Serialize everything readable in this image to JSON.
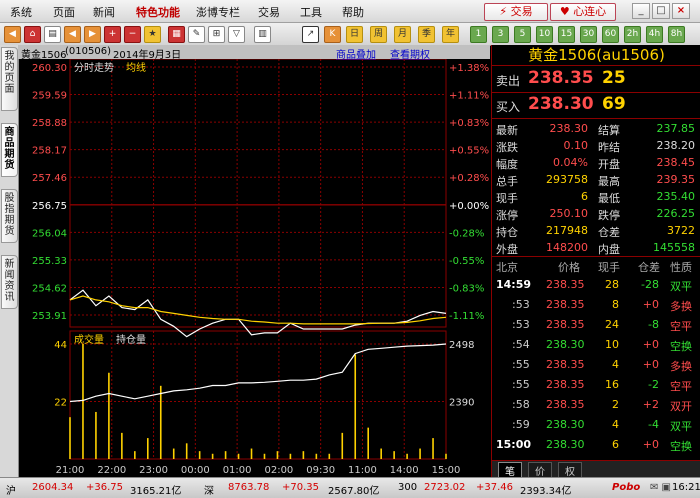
{
  "menu": {
    "items": [
      "系统",
      "页面",
      "新闻",
      "特色功能",
      "澎博专栏",
      "交易",
      "工具",
      "帮助"
    ],
    "trade_button": "交易",
    "xinlianxin_button": "心连心",
    "win_min": "_",
    "win_max": "□",
    "win_close": "×"
  },
  "toolbar": {
    "icons": [
      "home-icon",
      "page-icon",
      "prev-icon",
      "next-icon",
      "zoom-in-icon",
      "zoom-out-icon",
      "analysis-icon",
      "pen-icon",
      "split-icon",
      "filter-icon",
      "table-icon",
      "tick-chart-icon",
      "kline-icon"
    ],
    "period_buttons": [
      "日",
      "周",
      "月",
      "季",
      "年"
    ],
    "num_buttons": [
      "1",
      "3",
      "5",
      "10",
      "15",
      "30",
      "60",
      "2h",
      "4h",
      "8h"
    ],
    "gray_label": "日"
  },
  "left_tabs": [
    "我的页面",
    "商品期货",
    "股指期货",
    "新闻资讯"
  ],
  "chart": {
    "header": {
      "name": "黄金1506",
      "code": "(010506)",
      "date": "2014年9月3日",
      "link1": "商品叠加",
      "link2": "查看期权"
    },
    "price_label": "分时走势",
    "ma_label": "均线",
    "vol_label": "成交量",
    "oi_label": "持仓量",
    "price_ticks": [
      "260.30",
      "259.59",
      "258.88",
      "258.17",
      "257.46",
      "256.75",
      "256.04",
      "255.33",
      "254.62",
      "253.91"
    ],
    "pct_ticks": [
      "+1.38%",
      "+1.11%",
      "+0.83%",
      "+0.55%",
      "+0.28%",
      "+0.00%",
      "-0.28%",
      "-0.55%",
      "-0.83%",
      "-1.11%"
    ],
    "vol_ticks": [
      "44",
      "22"
    ],
    "oi_ticks": [
      "2498",
      "2390"
    ],
    "time_ticks": [
      "21:00",
      "22:00",
      "23:00",
      "00:00",
      "01:00",
      "02:00",
      "09:30",
      "11:00",
      "14:00",
      "15:00"
    ]
  },
  "chart_data": {
    "type": "line",
    "title": "分时走势",
    "x": [
      "21:00",
      "21:10",
      "21:20",
      "21:30",
      "21:40",
      "21:50",
      "22:00",
      "22:10",
      "22:20",
      "22:30",
      "22:40",
      "22:50",
      "23:00",
      "23:30",
      "00:00",
      "00:30",
      "01:00",
      "01:30",
      "02:00",
      "02:30",
      "09:00",
      "09:30",
      "10:00",
      "10:30",
      "11:00",
      "11:30",
      "13:30",
      "14:00",
      "14:30",
      "15:00"
    ],
    "ylim": [
      253.91,
      260.3
    ],
    "reference_price": 256.75,
    "series": [
      {
        "name": "分时走势",
        "values": [
          254.3,
          254.55,
          254.15,
          254.4,
          254.1,
          254.05,
          254.3,
          253.8,
          253.62,
          253.35,
          253.55,
          253.7,
          253.8,
          253.8,
          253.4,
          253.45,
          253.45,
          253.7,
          253.55,
          253.55,
          253.55,
          253.55,
          253.65,
          253.7,
          253.7,
          253.7,
          253.75,
          253.9,
          254.0,
          253.95
        ]
      },
      {
        "name": "均线",
        "values": [
          254.3,
          254.4,
          254.3,
          254.25,
          254.15,
          254.1,
          254.1,
          254.0,
          253.95,
          253.9,
          253.85,
          253.82,
          253.8,
          253.8,
          253.75,
          253.73,
          253.7,
          253.7,
          253.68,
          253.68,
          253.68,
          253.68,
          253.68,
          253.69,
          253.7,
          253.7,
          253.72,
          253.76,
          253.82,
          253.85
        ]
      },
      {
        "name": "持仓量",
        "values": [
          2390,
          2392,
          2400,
          2405,
          2400,
          2395,
          2400,
          2405,
          2410,
          2412,
          2415,
          2420,
          2420,
          2425,
          2425,
          2426,
          2428,
          2430,
          2430,
          2432,
          2440,
          2445,
          2480,
          2488,
          2490,
          2492,
          2494,
          2495,
          2496,
          2498
        ]
      }
    ],
    "volume": [
      16,
      44,
      18,
      33,
      10,
      3,
      8,
      28,
      4,
      6,
      3,
      2,
      3,
      2,
      4,
      2,
      3,
      2,
      3,
      2,
      2,
      10,
      40,
      12,
      4,
      3,
      2,
      4,
      8,
      2
    ]
  },
  "quote": {
    "title": "黄金1506(au1506)",
    "sell_label": "卖出",
    "sell_price": "238.35",
    "sell_vol": "25",
    "buy_label": "买入",
    "buy_price": "238.30",
    "buy_vol": "69",
    "stats": [
      {
        "l1": "最新",
        "v1": "238.30",
        "l2": "结算",
        "v2": "237.85",
        "c1": "up",
        "c2": "dn"
      },
      {
        "l1": "涨跌",
        "v1": "0.10",
        "l2": "昨结",
        "v2": "238.20",
        "c1": "up",
        "c2": "wt"
      },
      {
        "l1": "幅度",
        "v1": "0.04%",
        "l2": "开盘",
        "v2": "238.45",
        "c1": "up",
        "c2": "up"
      },
      {
        "l1": "总手",
        "v1": "293758",
        "l2": "最高",
        "v2": "239.35",
        "c1": "yl",
        "c2": "up"
      },
      {
        "l1": "现手",
        "v1": "6",
        "l2": "最低",
        "v2": "235.40",
        "c1": "yl",
        "c2": "dn"
      },
      {
        "l1": "涨停",
        "v1": "250.10",
        "l2": "跌停",
        "v2": "226.25",
        "c1": "up",
        "c2": "dn"
      },
      {
        "l1": "持仓",
        "v1": "217948",
        "l2": "仓差",
        "v2": "3722",
        "c1": "yl",
        "c2": "yl"
      },
      {
        "l1": "外盘",
        "v1": "148200",
        "l2": "内盘",
        "v2": "145558",
        "c1": "up",
        "c2": "dn"
      }
    ],
    "tick_headers": [
      "北京",
      "价格",
      "现手",
      "仓差",
      "性质"
    ],
    "ticks": [
      {
        "time": "14:59",
        "price": "238.35",
        "vol": "28",
        "diff": "-28",
        "nature": "双平",
        "pc": "up",
        "nc": "dn",
        "big": true
      },
      {
        "time": ":53",
        "price": "238.35",
        "vol": "8",
        "diff": "+0",
        "nature": "多换",
        "pc": "up",
        "nc": "up",
        "big": false
      },
      {
        "time": ":53",
        "price": "238.35",
        "vol": "24",
        "diff": "-8",
        "nature": "空平",
        "pc": "up",
        "nc": "up",
        "big": false
      },
      {
        "time": ":54",
        "price": "238.30",
        "vol": "10",
        "diff": "+0",
        "nature": "空换",
        "pc": "dn",
        "nc": "dn",
        "big": false
      },
      {
        "time": ":55",
        "price": "238.35",
        "vol": "4",
        "diff": "+0",
        "nature": "多换",
        "pc": "up",
        "nc": "up",
        "big": false
      },
      {
        "time": ":55",
        "price": "238.35",
        "vol": "16",
        "diff": "-2",
        "nature": "空平",
        "pc": "up",
        "nc": "up",
        "big": false
      },
      {
        "time": ":58",
        "price": "238.35",
        "vol": "2",
        "diff": "+2",
        "nature": "双开",
        "pc": "up",
        "nc": "up",
        "big": false
      },
      {
        "time": ":59",
        "price": "238.30",
        "vol": "4",
        "diff": "-4",
        "nature": "双平",
        "pc": "dn",
        "nc": "dn",
        "big": false
      },
      {
        "time": "15:00",
        "price": "238.30",
        "vol": "6",
        "diff": "+0",
        "nature": "空换",
        "pc": "dn",
        "nc": "dn",
        "big": true
      }
    ],
    "tabs": [
      "笔",
      "价",
      "权"
    ]
  },
  "status": {
    "items": [
      {
        "mkt": "沪",
        "price": "2604.34",
        "chg": "+36.75",
        "amt": "3165.21亿",
        "cls": "up"
      },
      {
        "mkt": "深",
        "price": "8763.78",
        "chg": "+70.35",
        "amt": "2567.80亿",
        "cls": "up"
      },
      {
        "mkt": "300",
        "price": "2723.02",
        "chg": "+37.46",
        "amt": "2393.34亿",
        "cls": "up"
      }
    ],
    "brand": "Pobo",
    "time": "16:21"
  },
  "colors": {
    "up": "#ff4d4d",
    "down": "#33dd33",
    "yellow": "#ffd200",
    "grid": "#8b0000"
  }
}
